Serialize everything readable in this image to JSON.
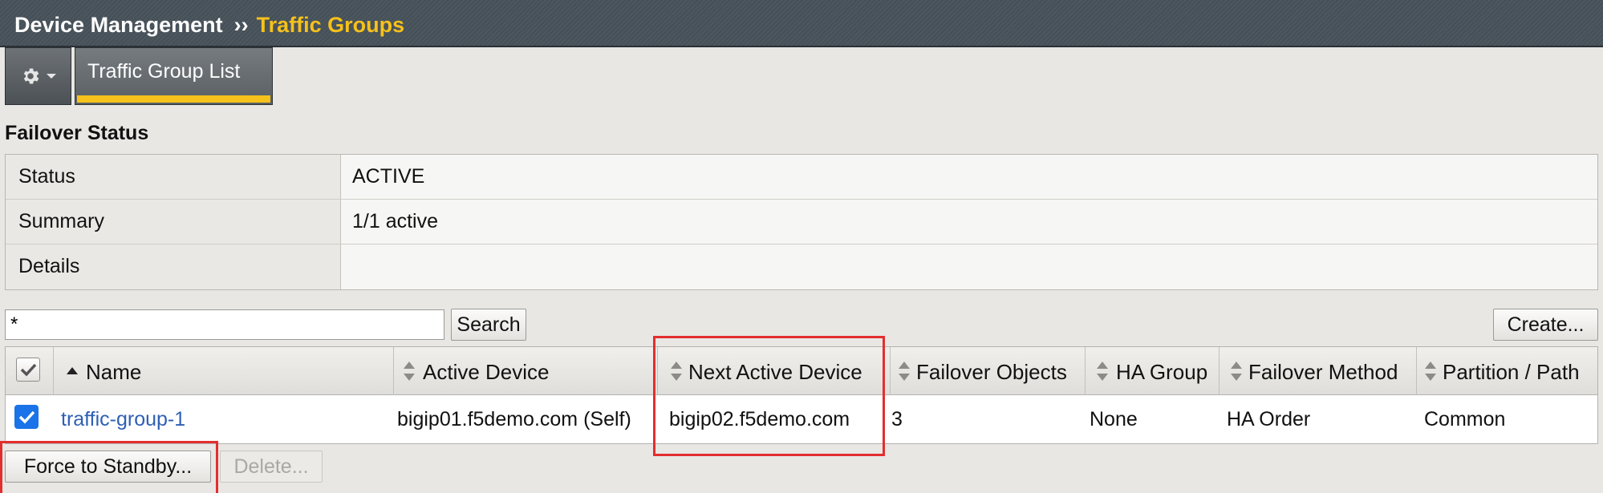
{
  "breadcrumb": {
    "section": "Device Management",
    "separator": "››",
    "current": "Traffic Groups"
  },
  "toolbar": {
    "gear_icon": "gear-icon",
    "dropdown_icon": "chevron-down-icon",
    "tabs": [
      {
        "label": "Traffic Group List",
        "selected": true
      }
    ]
  },
  "failover_status": {
    "title": "Failover Status",
    "rows": [
      {
        "label": "Status",
        "value": "ACTIVE"
      },
      {
        "label": "Summary",
        "value": "1/1 active"
      },
      {
        "label": "Details",
        "value": ""
      }
    ]
  },
  "search": {
    "value": "*",
    "button": "Search"
  },
  "create_button": "Create...",
  "table": {
    "columns": [
      "Name",
      "Active Device",
      "Next Active Device",
      "Failover Objects",
      "HA Group",
      "Failover Method",
      "Partition / Path"
    ],
    "rows": [
      {
        "checked": true,
        "name": "traffic-group-1",
        "active_device": "bigip01.f5demo.com (Self)",
        "next_active_device": "bigip02.f5demo.com",
        "failover_objects": "3",
        "ha_group": "None",
        "failover_method": "HA Order",
        "partition": "Common"
      }
    ]
  },
  "actions": {
    "force_standby": "Force to Standby...",
    "delete": "Delete..."
  },
  "colors": {
    "header_bg": "#47525a",
    "accent": "#f6c11b",
    "link": "#2e5fb5",
    "highlight": "#e32e2e",
    "checkbox": "#1a73e8"
  }
}
